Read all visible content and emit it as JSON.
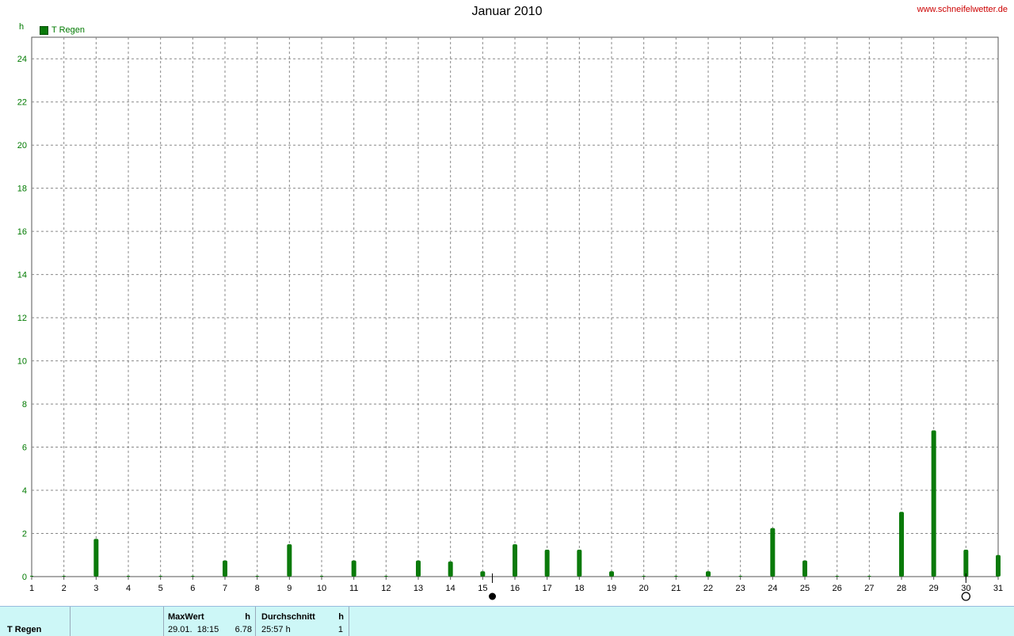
{
  "header": {
    "title": "Januar 2010",
    "source": "www.schneifelwetter.de",
    "y_unit": "h"
  },
  "legend": {
    "label": "T Regen",
    "color": "#0a7a0a"
  },
  "chart_data": {
    "type": "bar",
    "title": "Januar 2010",
    "ylabel": "h",
    "xlabel": "",
    "ylim": [
      0,
      25
    ],
    "grid": true,
    "legend_position": "top-left",
    "y_ticks": [
      0,
      2,
      4,
      6,
      8,
      10,
      12,
      14,
      16,
      18,
      20,
      22,
      24
    ],
    "categories": [
      "1",
      "2",
      "3",
      "4",
      "5",
      "6",
      "7",
      "8",
      "9",
      "10",
      "11",
      "12",
      "13",
      "14",
      "15",
      "16",
      "17",
      "18",
      "19",
      "20",
      "21",
      "22",
      "23",
      "24",
      "25",
      "26",
      "27",
      "28",
      "29",
      "30",
      "31"
    ],
    "series": [
      {
        "name": "T Regen",
        "color": "#0a7a0a",
        "values": [
          0,
          0,
          1.75,
          0,
          0,
          0,
          0.75,
          0,
          1.5,
          0,
          0.75,
          0,
          0.75,
          0.7,
          0.25,
          1.5,
          1.25,
          1.25,
          0.25,
          0,
          0,
          0.25,
          0,
          2.25,
          0.75,
          0,
          0,
          3.0,
          6.78,
          1.25,
          1.0
        ]
      }
    ],
    "moon_phases": [
      {
        "day": 15.3,
        "phase": "new"
      },
      {
        "day": 30.0,
        "phase": "full"
      }
    ]
  },
  "stats": {
    "row_label": "T Regen",
    "max_header": "MaxWert",
    "max_unit": "h",
    "max_time": "29.01.  18:15",
    "max_value": "6.78",
    "avg_header": "Durchschnitt",
    "avg_unit": "h",
    "avg_duration": "25:57 h",
    "avg_value": "1"
  }
}
